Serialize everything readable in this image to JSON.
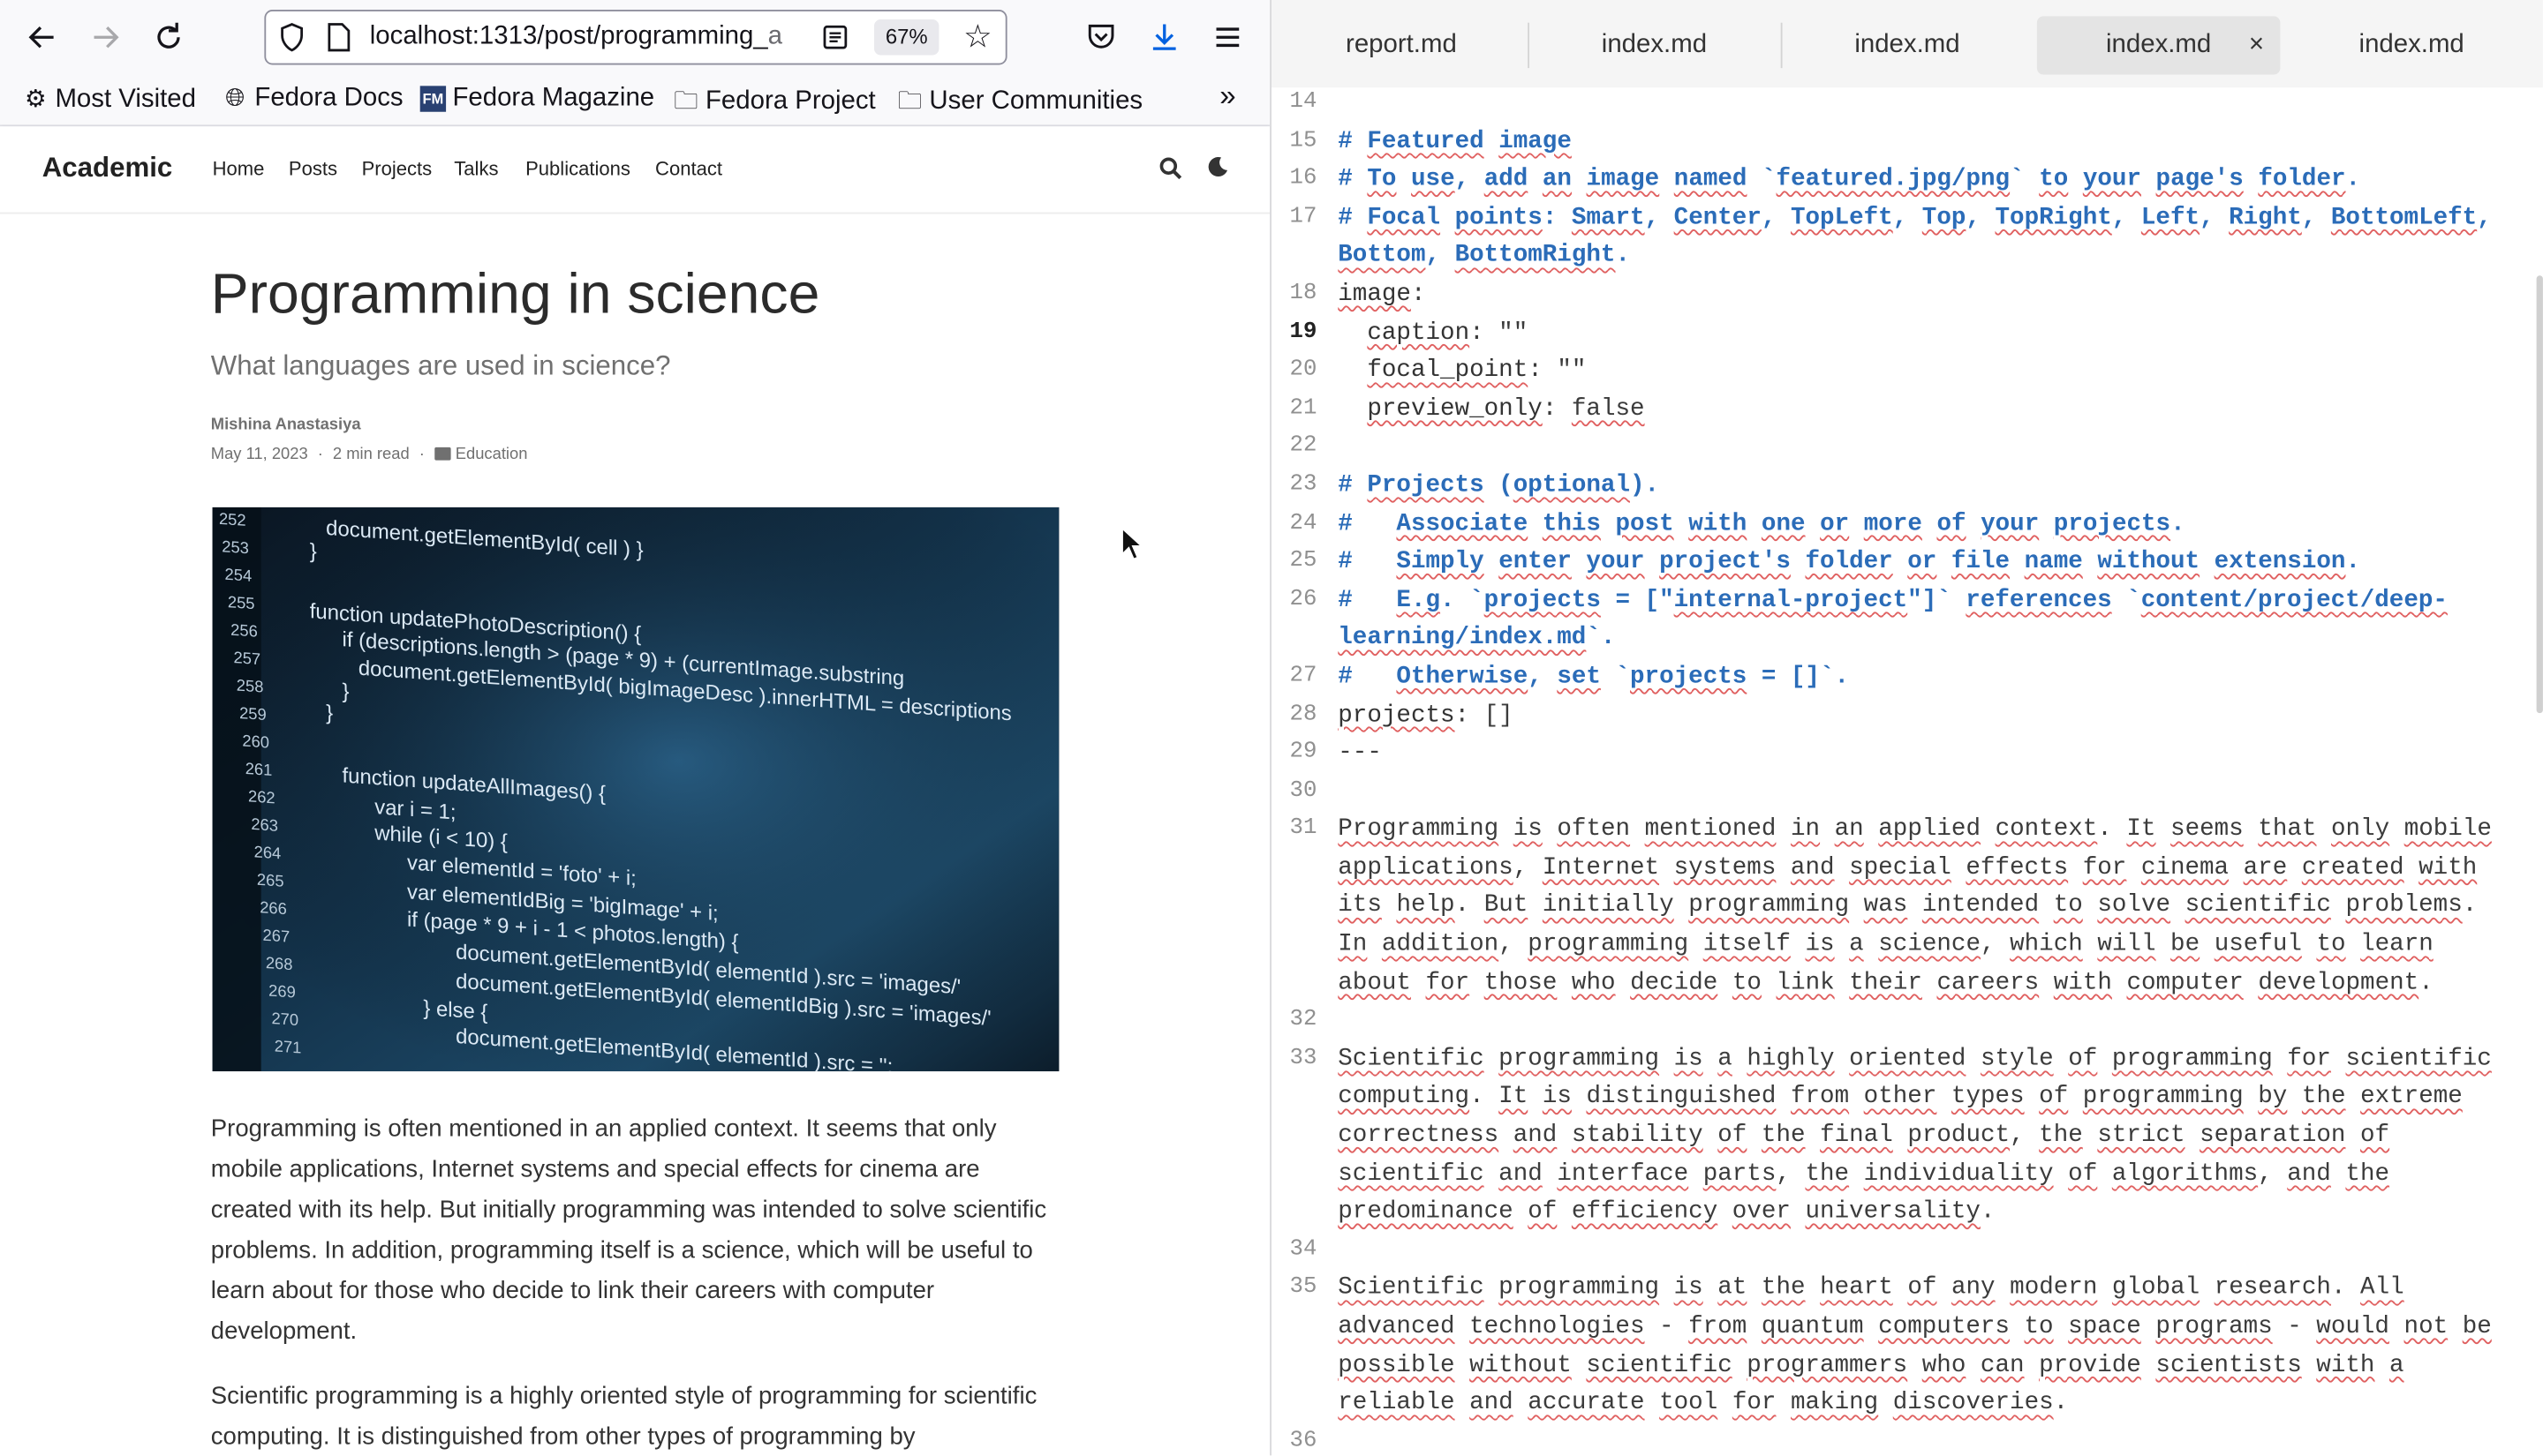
{
  "browser": {
    "url_main": "localhost:1313/post/programming_",
    "url_tail": "a",
    "zoom": "67%",
    "bookmarks": [
      "Most Visited",
      "Fedora Docs",
      "Fedora Magazine",
      "Fedora Project",
      "User Communities"
    ]
  },
  "site": {
    "brand": "Academic",
    "nav": [
      "Home",
      "Posts",
      "Projects",
      "Talks",
      "Publications",
      "Contact"
    ]
  },
  "article": {
    "title": "Programming in science",
    "subtitle": "What languages are used in science?",
    "author": "Mishina Anastasiya",
    "date": "May 11, 2023",
    "read_time": "2 min read",
    "category": "Education",
    "paragraph1": "Programming is often mentioned in an applied context. It seems that only mobile applications, Internet systems and special effects for cinema are created with its help. But initially programming was intended to solve scientific problems. In addition, programming itself is a science, which will be useful to learn about for those who decide to link their careers with computer development.",
    "paragraph2": "Scientific programming is a highly oriented style of programming for scientific computing. It is distinguished from other types of programming by"
  },
  "hero_code": {
    "line_numbers": [
      "252",
      "253",
      "254",
      "255",
      "256",
      "257",
      "258",
      "259",
      "260",
      "261",
      "262",
      "263",
      "264",
      "265",
      "266",
      "267",
      "268",
      "269",
      "270",
      "271"
    ],
    "lines": [
      "document.getElementById( cell ) }",
      "}",
      "function updatePhotoDescription() {",
      "if (descriptions.length > (page * 9) + (currentImage.substring",
      "document.getElementById( bigImageDesc ).innerHTML = descriptions",
      "}",
      "}",
      "function updateAllImages() {",
      "var i = 1;",
      "while (i < 10) {",
      "var elementId = 'foto' + i;",
      "var elementIdBig = 'bigImage' + i;",
      "if (page * 9 + i - 1 < photos.length) {",
      "document.getElementById( elementId ).src = 'images/'",
      "document.getElementById( elementIdBig ).src = 'images/'",
      "} else {",
      "document.getElementById( elementId ).src = '';"
    ]
  },
  "editor": {
    "tabs": [
      "report.md",
      "index.md",
      "index.md",
      "index.md",
      "index.md"
    ],
    "active_tab": 3,
    "close_glyph": "×",
    "lines": [
      {
        "n": "14",
        "t": ""
      },
      {
        "n": "15",
        "t": "# Featured image"
      },
      {
        "n": "16",
        "t": "# To use, add an image named `featured.jpg/png` to your page's folder."
      },
      {
        "n": "17",
        "t": "# Focal points: Smart, Center, TopLeft, Top, TopRight, Left, Right, BottomLeft, Bottom, BottomRight."
      },
      {
        "n": "18",
        "t": "image:"
      },
      {
        "n": "19",
        "t": "  caption: \"\""
      },
      {
        "n": "20",
        "t": "  focal_point: \"\""
      },
      {
        "n": "21",
        "t": "  preview_only: false"
      },
      {
        "n": "22",
        "t": ""
      },
      {
        "n": "23",
        "t": "# Projects (optional)."
      },
      {
        "n": "24",
        "t": "#   Associate this post with one or more of your projects."
      },
      {
        "n": "25",
        "t": "#   Simply enter your project's folder or file name without extension."
      },
      {
        "n": "26",
        "t": "#   E.g. `projects = [\"internal-project\"]` references `content/project/deep-learning/index.md`."
      },
      {
        "n": "27",
        "t": "#   Otherwise, set `projects = []`."
      },
      {
        "n": "28",
        "t": "projects: []"
      },
      {
        "n": "29",
        "t": "---"
      },
      {
        "n": "30",
        "t": ""
      },
      {
        "n": "31",
        "t": "Programming is often mentioned in an applied context. It seems that only mobile applications, Internet systems and special effects for cinema are created with its help. But initially programming was intended to solve scientific problems. In addition, programming itself is a science, which will be useful to learn about for those who decide to link their careers with computer development."
      },
      {
        "n": "32",
        "t": ""
      },
      {
        "n": "33",
        "t": "Scientific programming is a highly oriented style of programming for scientific computing. It is distinguished from other types of programming by the extreme correctness and stability of the final product, the strict separation of scientific and interface parts, the individuality of algorithms, and the predominance of efficiency over universality."
      },
      {
        "n": "34",
        "t": ""
      },
      {
        "n": "35",
        "t": "Scientific programming is at the heart of any modern global research. All advanced technologies - from quantum computers to space programs - would not be possible without scientific programmers who can provide scientists with a reliable and accurate tool for making discoveries."
      },
      {
        "n": "36",
        "t": ""
      }
    ],
    "current_line": "19"
  }
}
